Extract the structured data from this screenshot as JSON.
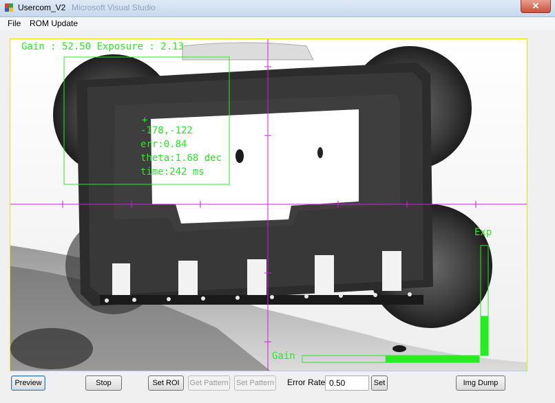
{
  "window": {
    "title": "Usercom_V2",
    "ghost_title": "Microsoft Visual Studio",
    "close_glyph": "✕"
  },
  "menu": [
    {
      "label": "File"
    },
    {
      "label": "ROM Update"
    }
  ],
  "overlay": {
    "gain_exposure": "Gain : 52.50 Exposure : 2.13",
    "match": {
      "marker": "+",
      "coords": "-178,-122",
      "err": "err:0.84",
      "theta": "theta:1.68 dec",
      "time": "time:242 ms"
    },
    "exp_label": "Exp",
    "gain_label": "Gain",
    "exp_level": 0.36,
    "gain_level": 0.53,
    "colors": {
      "overlay_green": "#22ee22",
      "crosshair": "#cc22cc",
      "roi_border": "#e6e600"
    }
  },
  "controls": {
    "preview": "Preview",
    "stop": "Stop",
    "set_roi": "Set ROI",
    "get_pattern": "Get Pattern",
    "set_pattern": "Set Pattern",
    "error_rate_label": "Error Rate",
    "error_rate_value": "0.50",
    "set": "Set",
    "img_dump": "Img Dump"
  }
}
